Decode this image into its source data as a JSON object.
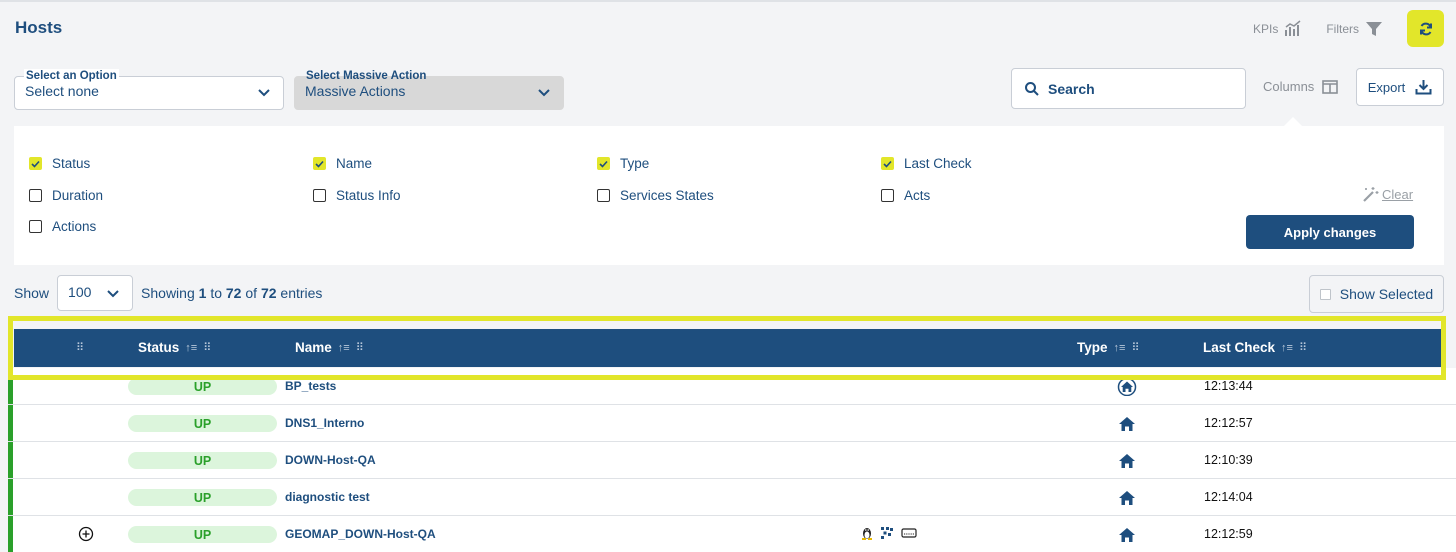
{
  "page": {
    "title": "Hosts"
  },
  "top_actions": {
    "kpis_label": "KPIs",
    "filters_label": "Filters"
  },
  "option_select": {
    "label": "Select an Option",
    "value": "Select none"
  },
  "massive_select": {
    "label": "Select Massive Action",
    "value": "Massive Actions"
  },
  "search": {
    "placeholder": "Search"
  },
  "columns_label": "Columns",
  "export_label": "Export",
  "column_options": [
    {
      "label": "Status",
      "checked": true
    },
    {
      "label": "Name",
      "checked": true
    },
    {
      "label": "Type",
      "checked": true
    },
    {
      "label": "Last Check",
      "checked": true
    },
    {
      "label": "Duration",
      "checked": false
    },
    {
      "label": "Status Info",
      "checked": false
    },
    {
      "label": "Services States",
      "checked": false
    },
    {
      "label": "Acts",
      "checked": false
    },
    {
      "label": "Actions",
      "checked": false
    }
  ],
  "clear_label": "Clear",
  "apply_label": "Apply changes",
  "show": {
    "label": "Show",
    "page_size": "100",
    "showing_prefix": "Showing",
    "from": "1",
    "to_word": "to",
    "to": "72",
    "of_word": "of",
    "total": "72",
    "suffix": "entries"
  },
  "show_selected_label": "Show Selected",
  "table": {
    "headers": {
      "status": "Status",
      "name": "Name",
      "type": "Type",
      "last_check": "Last Check"
    },
    "rows": [
      {
        "status": "UP",
        "name": "BP_tests",
        "type_icon": "home-circle-icon",
        "last_check": "12:13:44"
      },
      {
        "status": "UP",
        "name": "DNS1_Interno",
        "type_icon": "home-icon",
        "last_check": "12:12:57"
      },
      {
        "status": "UP",
        "name": "DOWN-Host-QA",
        "type_icon": "home-icon",
        "last_check": "12:10:39"
      },
      {
        "status": "UP",
        "name": "diagnostic test",
        "type_icon": "home-icon",
        "last_check": "12:14:04"
      },
      {
        "status": "UP",
        "name": "GEOMAP_DOWN-Host-QA",
        "type_icon": "home-icon",
        "last_check": "12:12:59"
      }
    ]
  },
  "colors": {
    "primary": "#1e4e7e",
    "accent": "#e2e62a",
    "status_up": "#2aa02a"
  }
}
